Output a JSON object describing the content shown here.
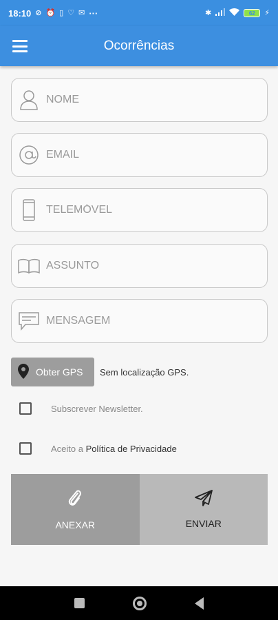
{
  "status_bar": {
    "time": "18:10",
    "more": "···",
    "battery": "62",
    "bluetooth": "✱"
  },
  "header": {
    "title": "Ocorrências",
    "menu_icon": "hamburger-menu-icon"
  },
  "form": {
    "fields": [
      {
        "placeholder": "NOME",
        "icon": "person-icon"
      },
      {
        "placeholder": "EMAIL",
        "icon": "at-sign-icon"
      },
      {
        "placeholder": "TELEMÓVEL",
        "icon": "mobile-phone-icon"
      },
      {
        "placeholder": "ASSUNTO",
        "icon": "book-icon"
      },
      {
        "placeholder": "MENSAGEM",
        "icon": "message-icon"
      }
    ],
    "gps_button_label": "Obter GPS",
    "gps_status": "Sem localização GPS.",
    "newsletter_label": "Subscrever Newsletter.",
    "privacy_prefix": "Aceito a",
    "privacy_link": "Política de Privacidade",
    "attach_label": "ANEXAR",
    "send_label": "ENVIAR"
  },
  "colors": {
    "primary": "#3d8fe0",
    "button_gray": "#9d9d9d",
    "button_light_gray": "#b9b9b9"
  }
}
